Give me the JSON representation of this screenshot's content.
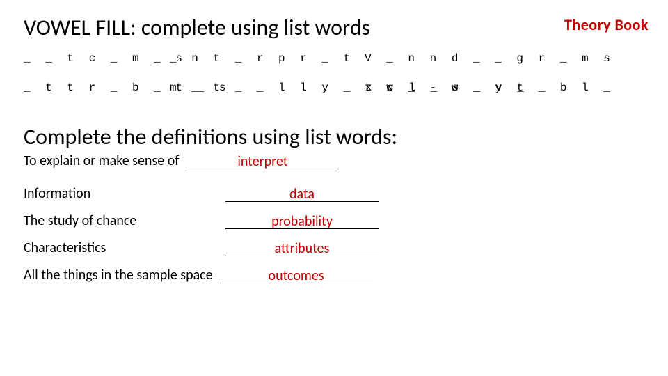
{
  "brand": "Theory Book",
  "title_vowel": "VOWEL FILL: complete using list words",
  "vowel_grid": {
    "r1c1": "_ _ t c _ m _ s",
    "r1c2": "_ n t _ r p r _ t",
    "r1c3": "V _ n n   d _ _ g r _ m s",
    "r2c1": "_ t t r _ b _ t _ s",
    "r2c2": "m _ t _ _ l l y _ x c l _ s _ v _",
    "r2c3": "t w _ - w _ y   t _ b l _"
  },
  "title_defs": "Complete the definitions using list words:",
  "defs": [
    {
      "clue": "To explain or make sense of",
      "answer": "interpret"
    },
    {
      "clue": "Information",
      "answer": "data"
    },
    {
      "clue": "The study of chance",
      "answer": "probability"
    },
    {
      "clue": "Characteristics",
      "answer": "attributes"
    },
    {
      "clue": "All the things in the sample space",
      "answer": "outcomes"
    }
  ]
}
